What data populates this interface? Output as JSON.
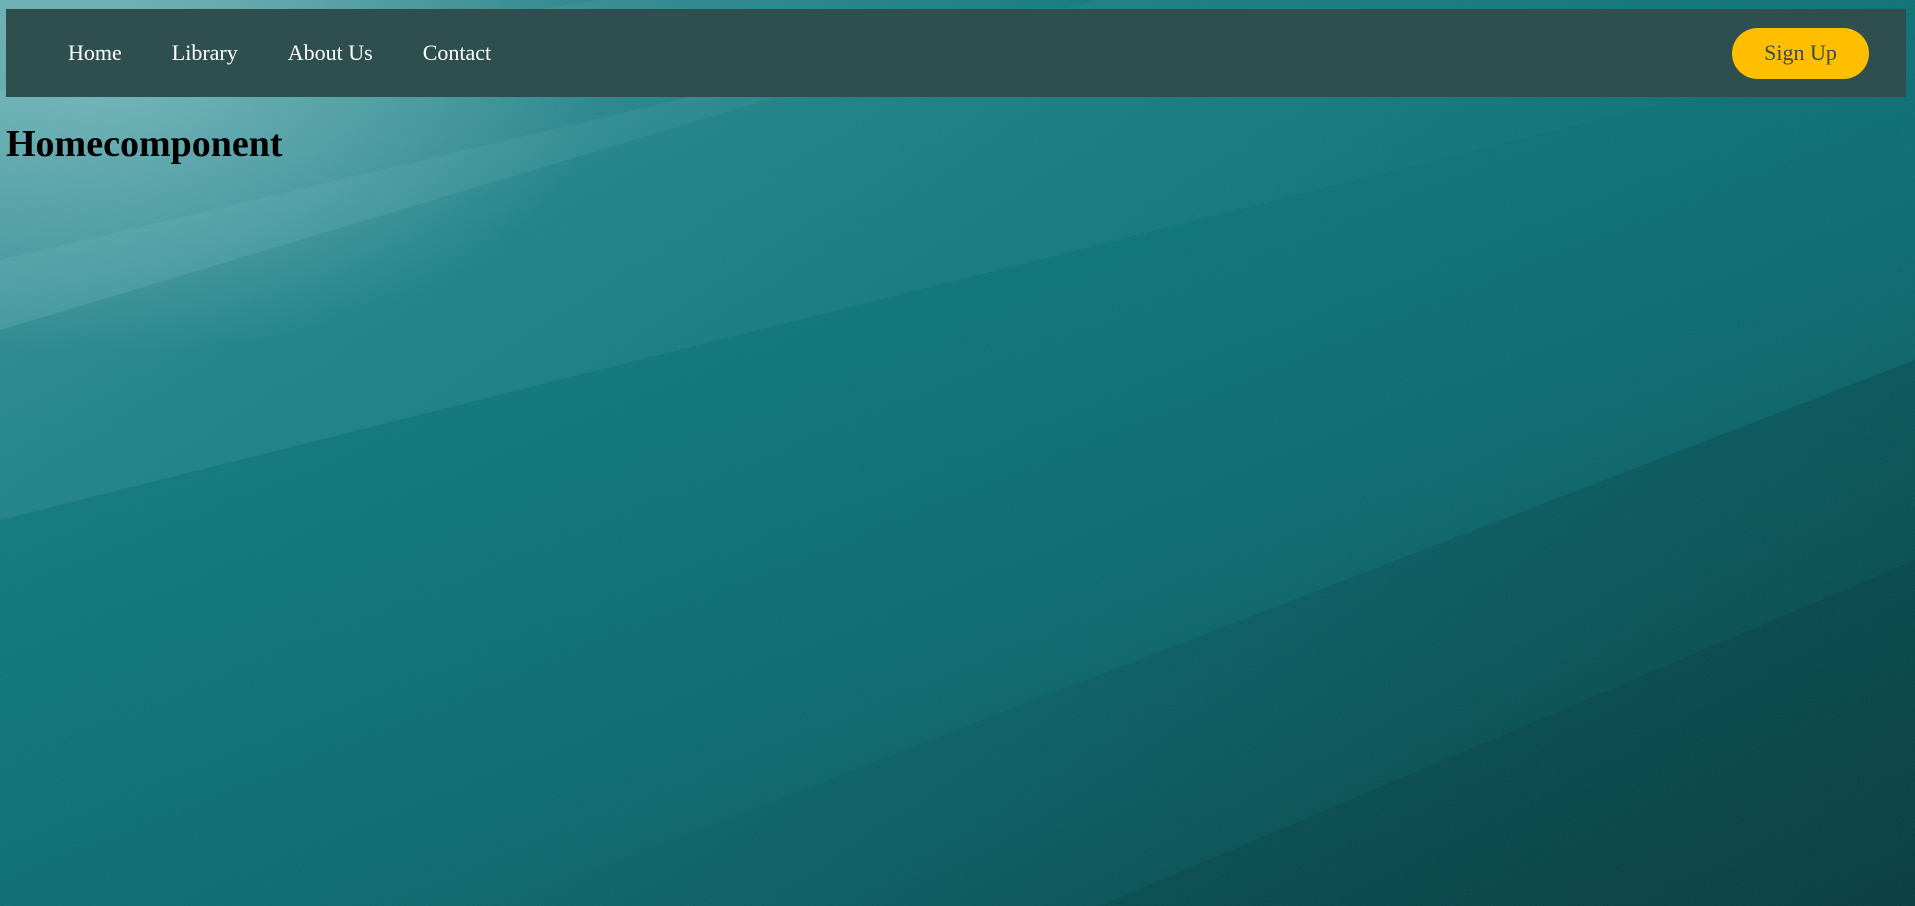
{
  "navbar": {
    "links": [
      {
        "label": "Home"
      },
      {
        "label": "Library"
      },
      {
        "label": "About Us"
      },
      {
        "label": "Contact"
      }
    ],
    "signup_label": "Sign Up"
  },
  "main": {
    "title": "Homecomponent"
  },
  "colors": {
    "navbar_bg": "#2f4f4f",
    "signup_bg": "#ffbf00",
    "background_teal": "#0b7378"
  }
}
